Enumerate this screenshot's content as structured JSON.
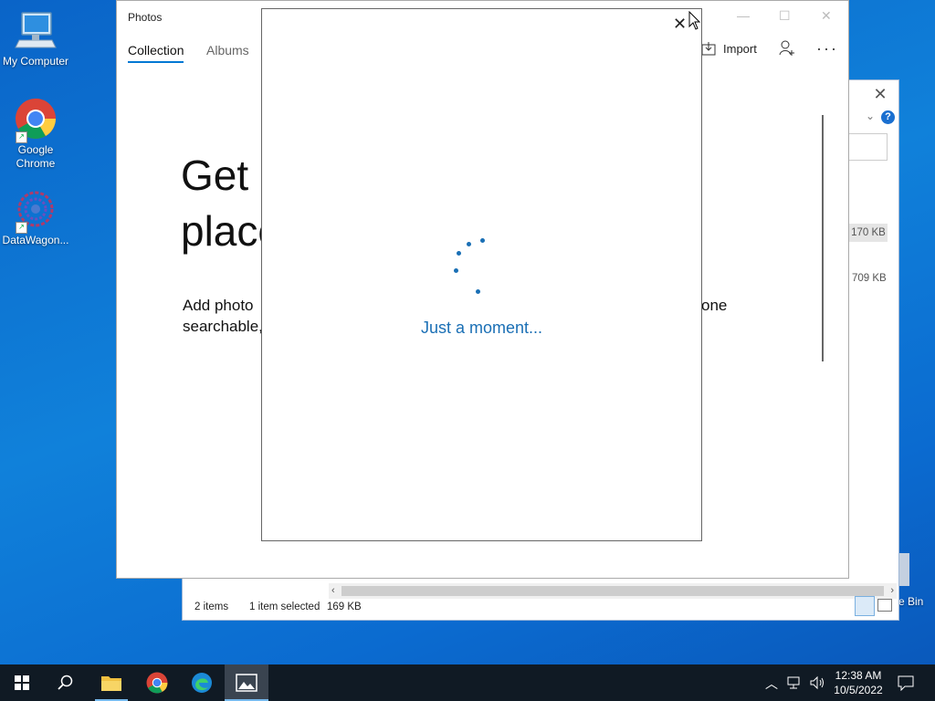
{
  "desktop": {
    "icons": [
      {
        "label": "My Computer"
      },
      {
        "label": "Google Chrome"
      },
      {
        "label": "DataWagon..."
      }
    ],
    "recycle_bin_partial_label": "e Bin"
  },
  "explorer": {
    "sizes": [
      "170 KB",
      "709 KB"
    ],
    "status": {
      "items": "2 items",
      "selected": "1 item selected",
      "size": "169 KB"
    }
  },
  "photos": {
    "title": "Photos",
    "tabs": [
      "Collection",
      "Albums"
    ],
    "import_label": "Import",
    "heading_line1": "Get a",
    "heading_line2": "place",
    "body_line1_left": "Add photo",
    "body_line1_right": "one",
    "body_line2_left": "searchable,"
  },
  "dialog": {
    "message": "Just a moment..."
  },
  "taskbar": {
    "time": "12:38 AM",
    "date": "10/5/2022"
  },
  "colors": {
    "accent": "#0078d4",
    "loading_text": "#1a6fb5",
    "taskbar": "#101a24"
  }
}
